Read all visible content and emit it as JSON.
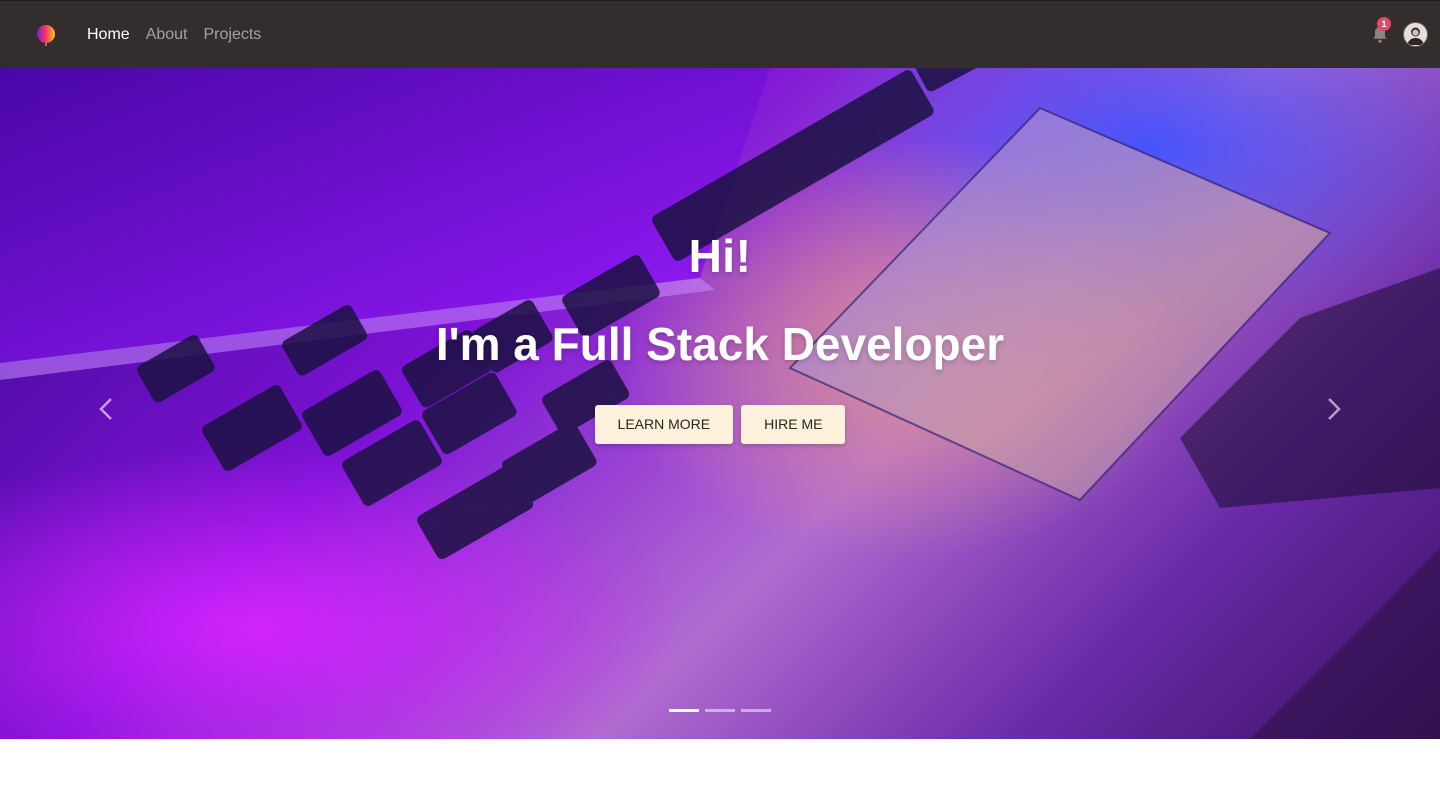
{
  "navbar": {
    "links": [
      {
        "label": "Home",
        "active": true
      },
      {
        "label": "About",
        "active": false
      },
      {
        "label": "Projects",
        "active": false
      }
    ],
    "notifications": {
      "icon": "bell-icon",
      "count": "1"
    },
    "avatar_icon": "user-avatar"
  },
  "hero": {
    "title": "Hi!",
    "subtitle": "I'm a Full Stack Developer",
    "buttons": {
      "learn_more": "LEARN MORE",
      "hire_me": "HIRE ME"
    },
    "controls": {
      "prev_icon": "chevron-left-icon",
      "next_icon": "chevron-right-icon"
    },
    "indicators": {
      "count": 3,
      "active_index": 0
    }
  },
  "colors": {
    "navbar_bg": "#332d2d",
    "button_bg": "#fdf1dc",
    "badge": "#dc4c64"
  }
}
